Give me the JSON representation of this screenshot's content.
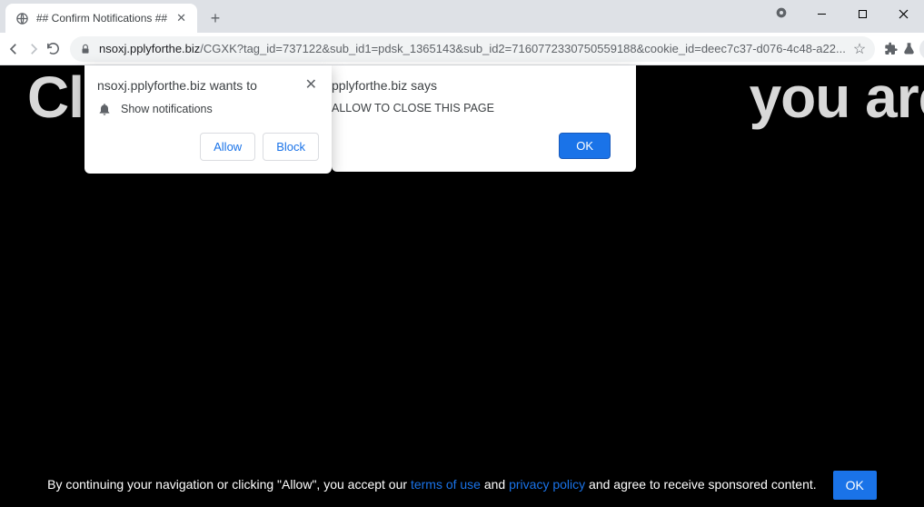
{
  "tab": {
    "title": "## Confirm Notifications ##"
  },
  "url": {
    "host": "nsoxj.pplyforthe.biz",
    "path": "/CGXK?tag_id=737122&sub_id1=pdsk_1365143&sub_id2=7160772330750559188&cookie_id=deec7c37-d076-4c48-a22..."
  },
  "page": {
    "heading_left": "Cli",
    "heading_right": "you are not a"
  },
  "perm": {
    "origin": "nsoxj.pplyforthe.biz wants to",
    "label": "Show notifications",
    "allow": "Allow",
    "block": "Block"
  },
  "alert": {
    "title": "pplyforthe.biz says",
    "message": "ALLOW TO CLOSE THIS PAGE",
    "ok": "OK"
  },
  "cookie": {
    "pre": "By continuing your navigation or clicking \"Allow\", you accept our ",
    "terms": "terms of use",
    "mid": " and ",
    "privacy": "privacy policy",
    "post": " and agree to receive sponsored content.",
    "ok": "OK"
  }
}
